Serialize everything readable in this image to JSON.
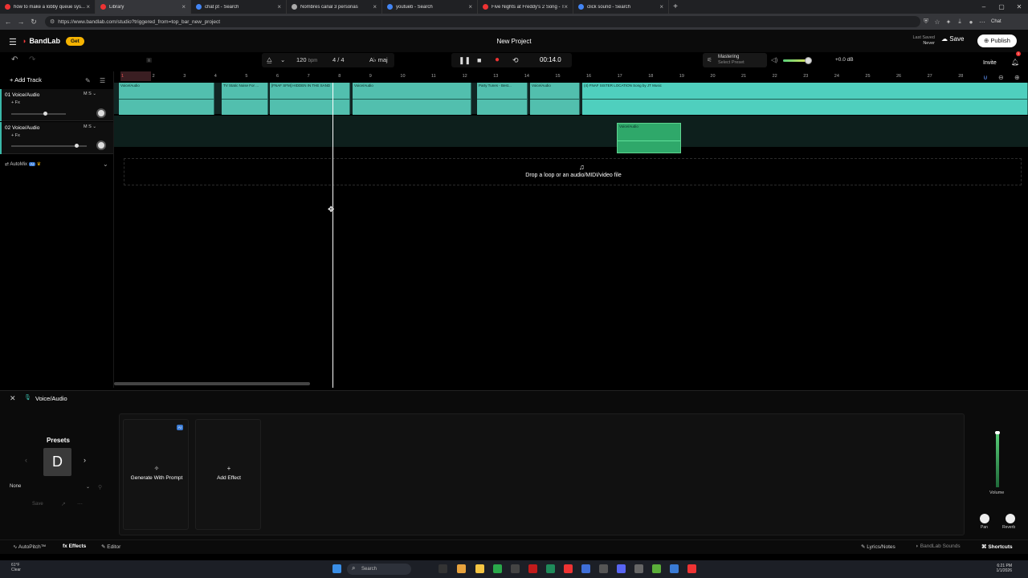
{
  "browser": {
    "tabs": [
      {
        "title": "how to make a lobby queue sys...",
        "color": "#e33"
      },
      {
        "title": "Library",
        "color": "#e33",
        "active": true
      },
      {
        "title": "chat pt - Search",
        "color": "#4285f4"
      },
      {
        "title": "Nombres canal 3 personas",
        "color": "#aaa"
      },
      {
        "title": "youtueb - Search",
        "color": "#4285f4"
      },
      {
        "title": "Five Nights at Freddy's 2 Song - T",
        "color": "#e33"
      },
      {
        "title": "click sound - Search",
        "color": "#4285f4"
      }
    ],
    "url": "https://www.bandlab.com/studio?triggered_from=top_bar_new_project",
    "chat_label": "Chat"
  },
  "header": {
    "logo": "BandLab",
    "get_label": "Get",
    "project_title": "New Project",
    "last_saved_label": "Last Saved",
    "last_saved_value": "Never",
    "save_label": "Save",
    "publish_label": "Publish"
  },
  "transport": {
    "bpm": "120",
    "bpm_unit": "bpm",
    "time_sig": "4 / 4",
    "key": "A♭ maj",
    "time": "00:14.0",
    "mastering_label": "Mastering",
    "mastering_preset": "Select Preset",
    "master_db": "+0.0 dB",
    "master_volume_fraction": 0.85,
    "invite_label": "Invite",
    "notifications": "1"
  },
  "tracks": {
    "add_track_label": "Add Track",
    "items": [
      {
        "name": "01 Voice/Audio",
        "fx": "+ Fx",
        "mute": "M",
        "solo": "S",
        "volume_fraction": 0.62
      },
      {
        "name": "02 Voice/Audio",
        "fx": "+ Fx",
        "mute": "M",
        "solo": "S",
        "volume_fraction": 0.86
      }
    ],
    "automix_label": "AutoMix",
    "automix_ai": "AI"
  },
  "ruler": {
    "bars": [
      "1",
      "2",
      "3",
      "4",
      "5",
      "6",
      "7",
      "8",
      "9",
      "10",
      "11",
      "12",
      "13",
      "14",
      "15",
      "16",
      "17",
      "18",
      "19",
      "20",
      "21",
      "22",
      "23",
      "24",
      "25",
      "26",
      "27",
      "28"
    ]
  },
  "clips": {
    "lane1": [
      "Voice/Audio",
      "TV Static Noise For ...",
      "[FNAF SFM] HIDDEN IN THE SAND",
      "Voice/Audio",
      "Party Tunes - Best...",
      "Voice/Audio",
      "(4) FNAF SISTER LOCATION Song by JT Music"
    ],
    "lane2": [
      "Voice/Audio"
    ]
  },
  "dropzone": {
    "text": "Drop a loop or an audio/MIDI/video file"
  },
  "bottom_panel": {
    "title": "Voice/Audio",
    "presets_label": "Presets",
    "preset_letter": "D",
    "preset_value": "None",
    "save_label": "Save",
    "generate_label": "Generate With Prompt",
    "generate_ai": "AI",
    "add_effect_label": "Add Effect",
    "volume_label": "Volume",
    "pan_label": "Pan",
    "reverb_label": "Reverb"
  },
  "footer": {
    "autopitch": "AutoPitch™",
    "effects": "Effects",
    "editor": "Editor",
    "lyrics": "Lyrics/Notes",
    "sounds": "BandLab Sounds",
    "shortcuts": "Shortcuts"
  },
  "taskbar": {
    "weather_temp": "61°F",
    "weather_desc": "Clear",
    "search_label": "Search",
    "time": "6:21 PM",
    "date": "1/1/2026"
  }
}
